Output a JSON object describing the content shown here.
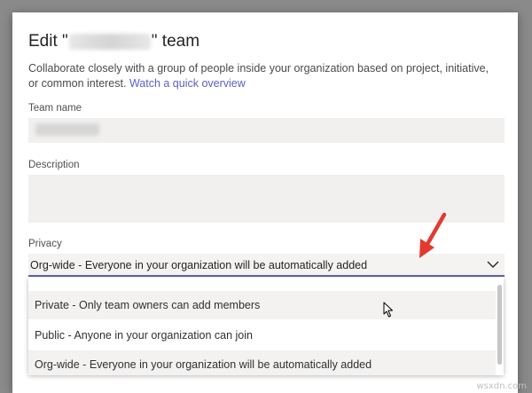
{
  "dialog": {
    "title_prefix": "Edit \"",
    "title_suffix": "\" team",
    "description": "Collaborate closely with a group of people inside your organization based on project, initiative, or common interest.",
    "overview_link": "Watch a quick overview",
    "team_name_label": "Team name",
    "description_label": "Description",
    "privacy_label": "Privacy",
    "privacy_selected": "Org-wide - Everyone in your organization will be automatically added"
  },
  "dropdown": {
    "options": [
      "Private - Only team owners can add members",
      "Public - Anyone in your organization can join",
      "Org-wide - Everyone in your organization will be automatically added"
    ]
  },
  "watermark": "wsxdn.com",
  "colors": {
    "accent": "#6264a7",
    "annotation_arrow": "#e23b2e",
    "field_background": "#f1f0ef"
  },
  "icons": [
    "chevron-down-icon",
    "annotation-arrow-icon",
    "mouse-cursor-icon"
  ]
}
